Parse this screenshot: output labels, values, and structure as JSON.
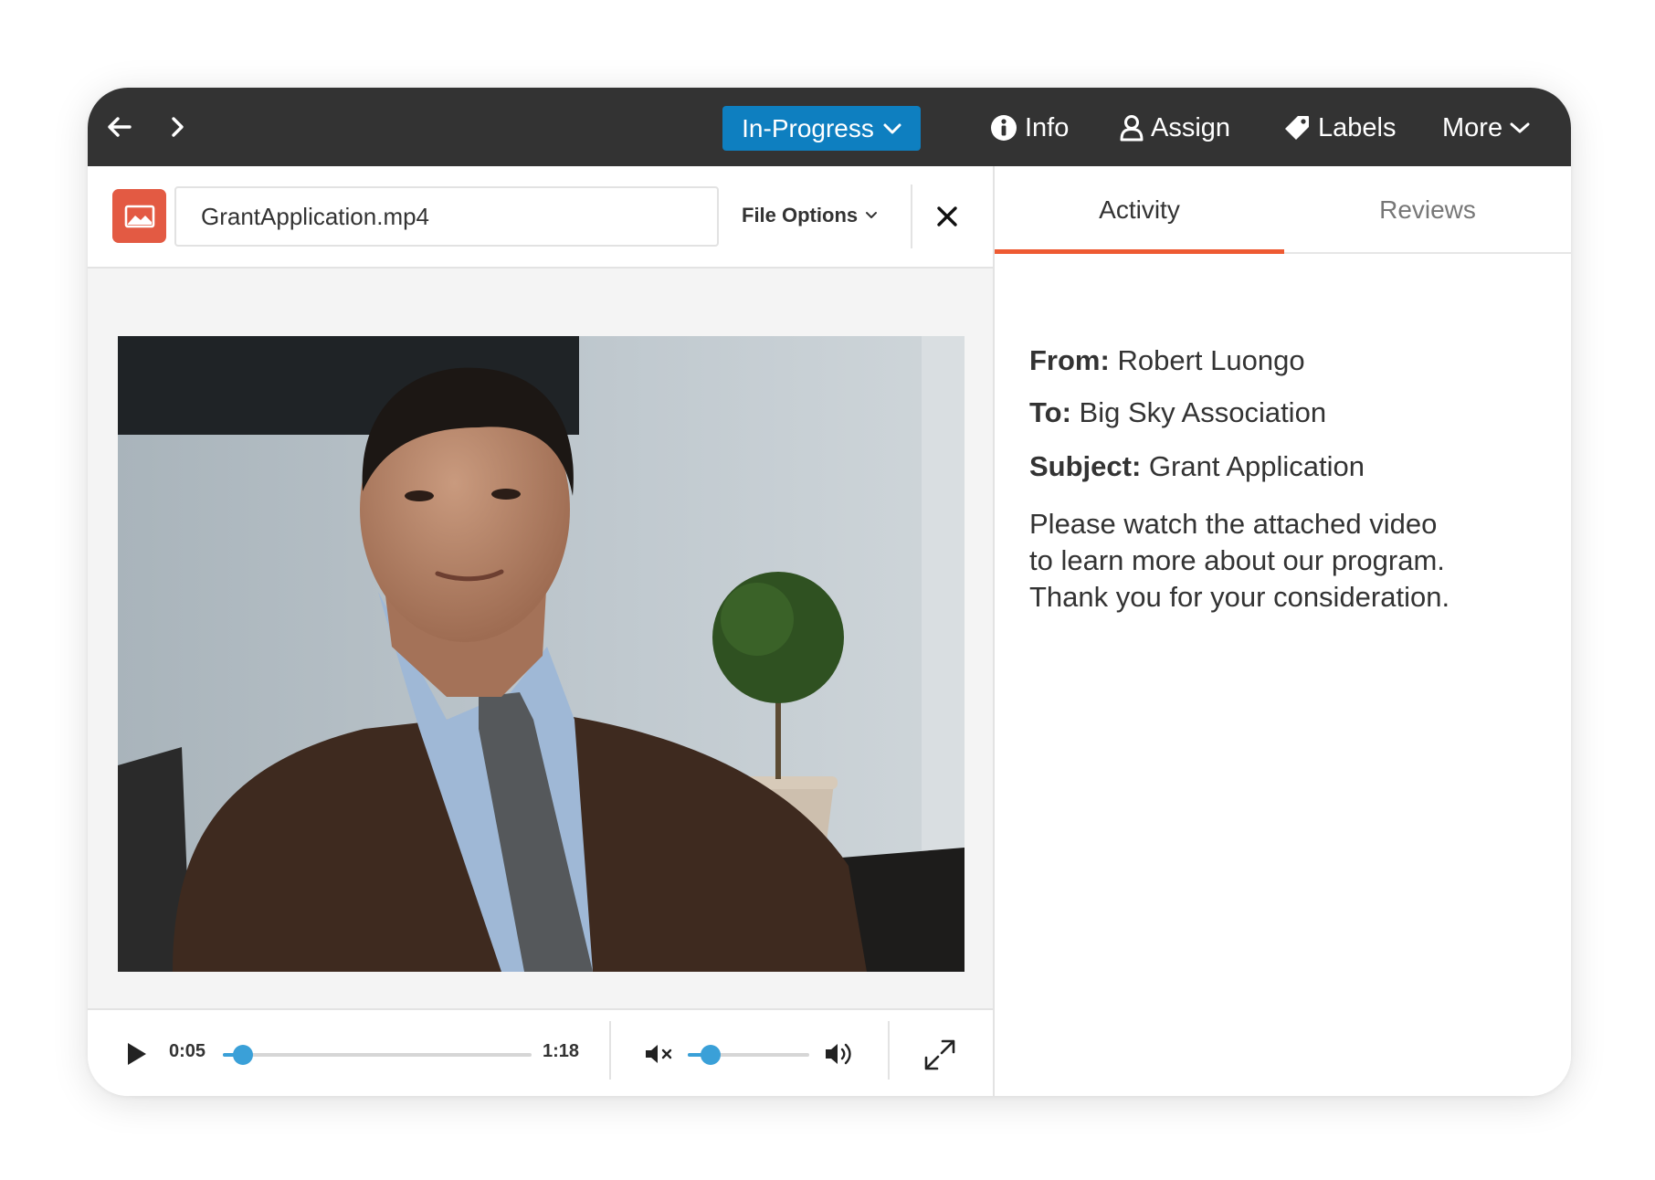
{
  "toolbar": {
    "back_icon": "arrow-left-icon",
    "forward_icon": "chevron-right-icon",
    "status": "In-Progress",
    "actions": {
      "info": "Info",
      "assign": "Assign",
      "labels": "Labels",
      "more": "More"
    }
  },
  "file": {
    "icon": "image-file-icon",
    "name": "GrantApplication.mp4",
    "options_label": "File Options"
  },
  "player": {
    "current_time": "0:05",
    "total_time": "1:18",
    "progress_fraction": 0.064,
    "volume_fraction": 0.19
  },
  "tabs": {
    "activity": "Activity",
    "reviews": "Reviews",
    "active": "activity"
  },
  "message": {
    "from_label": "From:",
    "from_value": "Robert Luongo",
    "to_label": "To:",
    "to_value": "Big Sky Association",
    "subject_label": "Subject:",
    "subject_value": "Grant Application",
    "body_lines": [
      "Please watch the attached video",
      "to learn more about our program.",
      "Thank you for your consideration."
    ]
  },
  "colors": {
    "topbar": "#333333",
    "status_button": "#0e7fc0",
    "file_icon": "#e35a43",
    "tab_accent": "#ee5a32",
    "slider": "#3aa0d8"
  }
}
